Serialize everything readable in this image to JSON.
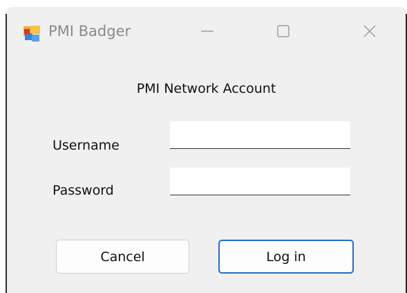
{
  "window": {
    "title": "PMI Badger",
    "app_icon": "pmi-badger-app-icon",
    "controls": {
      "minimize_icon": "minimize-icon",
      "maximize_icon": "maximize-icon",
      "close_icon": "close-icon"
    }
  },
  "form": {
    "heading": "PMI Network Account",
    "username_label": "Username",
    "username_value": "",
    "password_label": "Password",
    "password_value": ""
  },
  "buttons": {
    "cancel_label": "Cancel",
    "login_label": "Log in"
  },
  "colors": {
    "dialog_background": "#f0f0f0",
    "accent_border": "#1f6fc4",
    "title_text": "#8a8a8a"
  }
}
